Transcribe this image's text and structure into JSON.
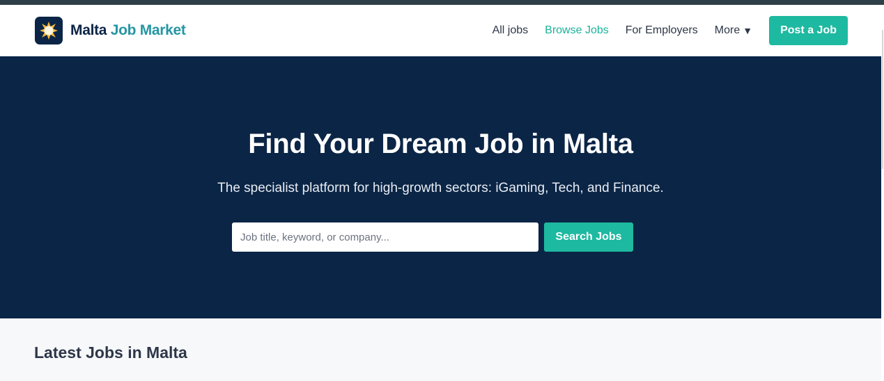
{
  "brand": {
    "name_part1": "Malta",
    "name_part2": "Job Market",
    "logo_icon": "sun-star-icon",
    "colors": {
      "navy": "#0b2546",
      "teal": "#1db9a0",
      "link_teal": "#2596a4"
    }
  },
  "nav": {
    "items": [
      {
        "label": "All jobs",
        "active": false
      },
      {
        "label": "Browse Jobs",
        "active": true
      },
      {
        "label": "For Employers",
        "active": false
      }
    ],
    "more_label": "More",
    "more_icon": "caret-down-icon",
    "post_button": "Post a Job"
  },
  "hero": {
    "title": "Find Your Dream Job in Malta",
    "subtitle": "The specialist platform for high-growth sectors: iGaming, Tech, and Finance.",
    "search": {
      "placeholder": "Job title, keyword, or company...",
      "value": "",
      "button": "Search Jobs"
    }
  },
  "latest": {
    "heading": "Latest Jobs in Malta"
  }
}
